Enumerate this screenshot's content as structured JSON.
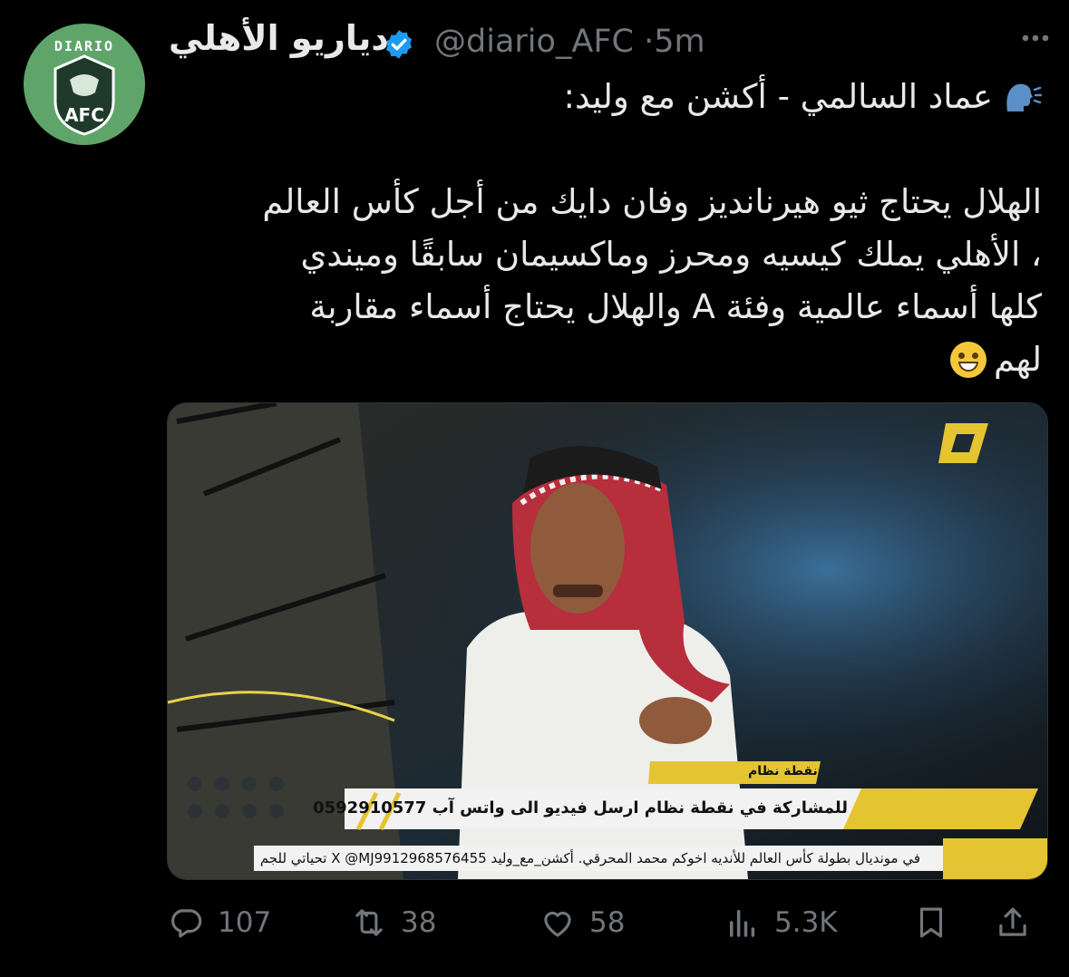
{
  "avatar": {
    "label": "DIARIO",
    "sub": "AFC"
  },
  "header": {
    "name": "دياريو الأهلي",
    "handle": "@diario_AFC",
    "separator": "·",
    "time": "5m"
  },
  "tweet": {
    "line1": "عماد السالمي - أكشن مع وليد:",
    "line2": "الهلال يحتاج ثيو هيرنانديز وفان دايك من أجل كأس العالم",
    "line3": "، الأهلي يملك كيسيه ومحرز وماكسيمان سابقًا وميندي",
    "line4": "كلها أسماء عالمية وفئة A والهلال يحتاج أسماء مقاربة",
    "line5": "لهم"
  },
  "media": {
    "lower_third_label": "نقطة نظام",
    "lower_third_text": "للمشاركة في نقطة نظام ارسل فيديو الى واتس آب 0592910577",
    "ticker": "في مونديال بطولة كأس العالم للأنديه اخوكم محمد المحرقي. أكشن_مع_وليد X @MJ9912968576455 تحياتي للجم"
  },
  "actions": {
    "replies": "107",
    "reposts": "38",
    "likes": "58",
    "views": "5.3K"
  },
  "colors": {
    "background": "#000000",
    "text": "#e7e9ea",
    "muted": "#71767b",
    "verified": "#1d9bf0",
    "avatar": "#5fa56a"
  },
  "icons": [
    "more-icon",
    "verified-badge-icon",
    "speaking-head-icon",
    "sweat-smile-emoji",
    "reply-icon",
    "repost-icon",
    "like-icon",
    "views-icon",
    "bookmark-icon",
    "share-icon"
  ]
}
